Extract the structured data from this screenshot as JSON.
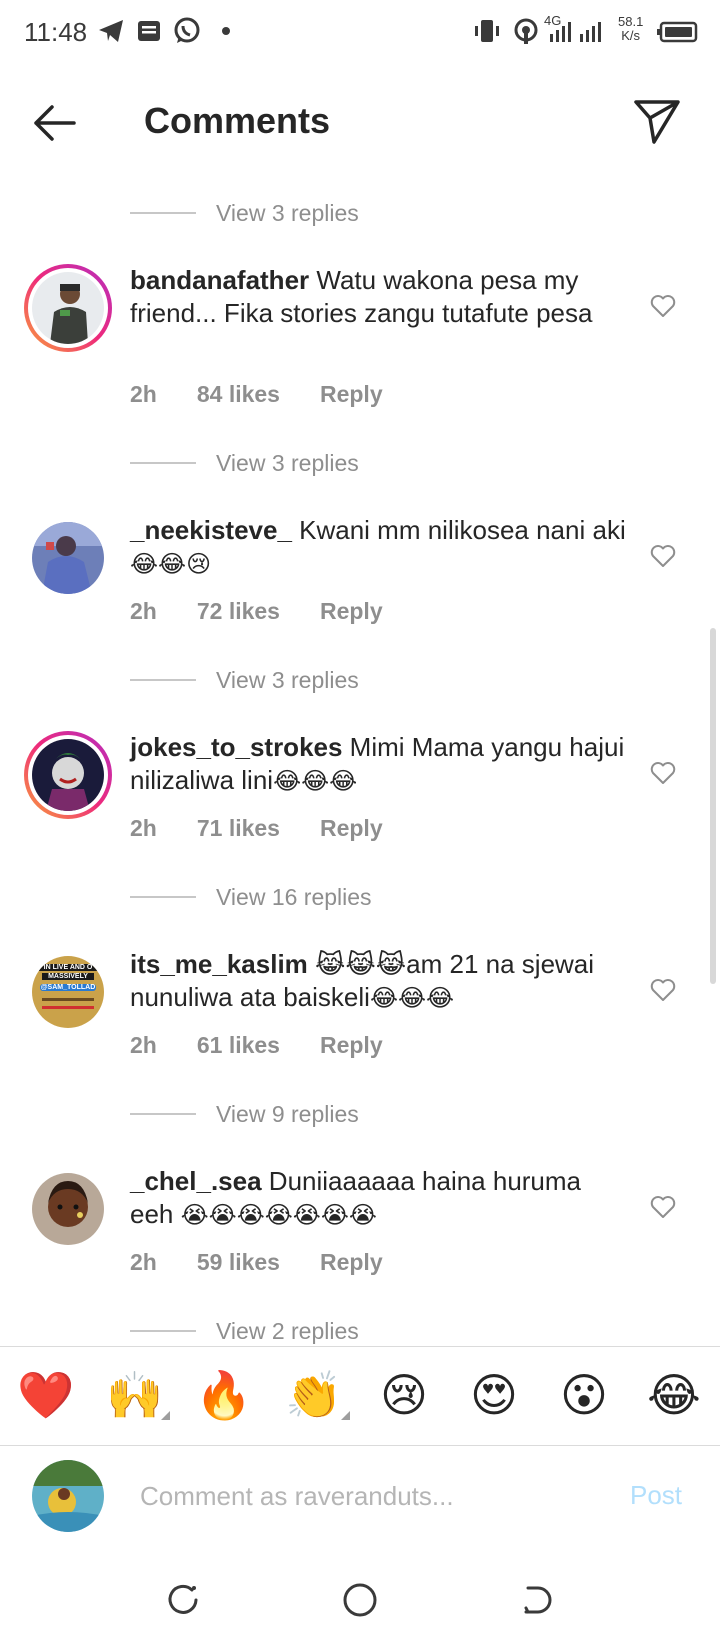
{
  "status_bar": {
    "time": "11:48",
    "speed_value": "58.1",
    "speed_unit": "K/s",
    "network": "4G",
    "icons": [
      "telegram-icon",
      "news-icon",
      "whatsapp-icon",
      "dot-icon",
      "vibrate-icon",
      "hotspot-icon",
      "signal-icon",
      "battery-icon"
    ]
  },
  "header": {
    "title": "Comments",
    "back_icon": "arrow-left-icon",
    "send_icon": "paper-plane-icon"
  },
  "comments": [
    {
      "replies_above": "View 3 replies",
      "username": "bandanafather",
      "text": " Watu wakona pesa my friend... Fika stories zangu tutafute pesa",
      "emoji": "",
      "time": "2h",
      "likes": "84 likes",
      "reply": "Reply",
      "has_story_ring": true
    },
    {
      "replies_above": "View 3 replies",
      "username": "_neekisteve_",
      "text": " Kwani mm nilikosea nani aki",
      "emoji": "😂😂😢",
      "time": "2h",
      "likes": "72 likes",
      "reply": "Reply",
      "has_story_ring": false
    },
    {
      "replies_above": "View 3 replies",
      "username": "jokes_to_strokes",
      "text": " Mimi Mama yangu hajui nilizaliwa lini",
      "emoji": "😂😂😂",
      "time": "2h",
      "likes": "71 likes",
      "reply": "Reply",
      "has_story_ring": true
    },
    {
      "replies_above": "View 16 replies",
      "username": "its_me_kaslim",
      "text": " 😹😹😹am 21 na sjewai nunuliwa ata baiskeli",
      "emoji": "😂😂😂",
      "time": "2h",
      "likes": "61 likes",
      "reply": "Reply",
      "has_story_ring": false,
      "avatar_text": [
        "IN LIVE AND O",
        "MASSIVELY",
        "@SAM_TOLLAD"
      ]
    },
    {
      "replies_above": "View 9 replies",
      "username": "_chel_.sea",
      "text": " Duniiaaaaaa haina huruma eeh ",
      "emoji": "😭😭😭😭😭😭😭",
      "time": "2h",
      "likes": "59 likes",
      "reply": "Reply",
      "has_story_ring": false
    }
  ],
  "last_replies": "View 2 replies",
  "reactions": [
    "❤️",
    "🙌",
    "🔥",
    "👏",
    "😢",
    "😍",
    "😮",
    "😂"
  ],
  "compose": {
    "placeholder": "Comment as raveranduts...",
    "post_label": "Post"
  },
  "colors": {
    "accent_disabled": "#b2dffc",
    "secondary_text": "#8e8e8e",
    "primary_text": "#262626",
    "story_ring_start": "#f9a23a",
    "story_ring_end": "#b42ec1"
  }
}
